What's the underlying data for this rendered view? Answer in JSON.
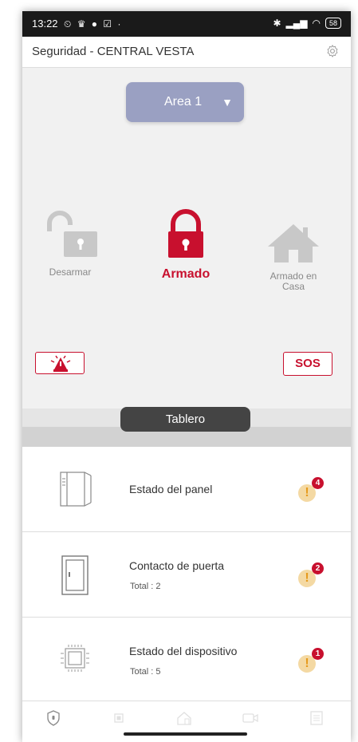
{
  "status_bar": {
    "time": "13:22",
    "battery": "58"
  },
  "header": {
    "title": "Seguridad - CENTRAL VESTA",
    "settings_icon": "gear-icon"
  },
  "area_selector": {
    "selected": "Area 1",
    "caret": "▼"
  },
  "modes": {
    "disarm": {
      "label": "Desarmar",
      "icon": "unlocked-padlock-icon"
    },
    "armed": {
      "label": "Armado",
      "icon": "locked-padlock-icon",
      "active": true
    },
    "home": {
      "label": "Armado en Casa",
      "icon": "house-icon"
    }
  },
  "alarm_buttons": {
    "panic_icon": "alarm-siren-icon",
    "sos_label": "SOS"
  },
  "tablero": {
    "label": "Tablero"
  },
  "rows": [
    {
      "title": "Estado del panel",
      "subtitle": "",
      "badge": "4",
      "icon": "panel-icon"
    },
    {
      "title": "Contacto de puerta",
      "subtitle": "Total : 2",
      "badge": "2",
      "icon": "door-icon"
    },
    {
      "title": "Estado del dispositivo",
      "subtitle": "Total : 5",
      "badge": "1",
      "icon": "chip-icon"
    }
  ],
  "colors": {
    "accent": "#c8102e",
    "area_button": "#9aa0c2",
    "warning": "#e69a1c"
  }
}
